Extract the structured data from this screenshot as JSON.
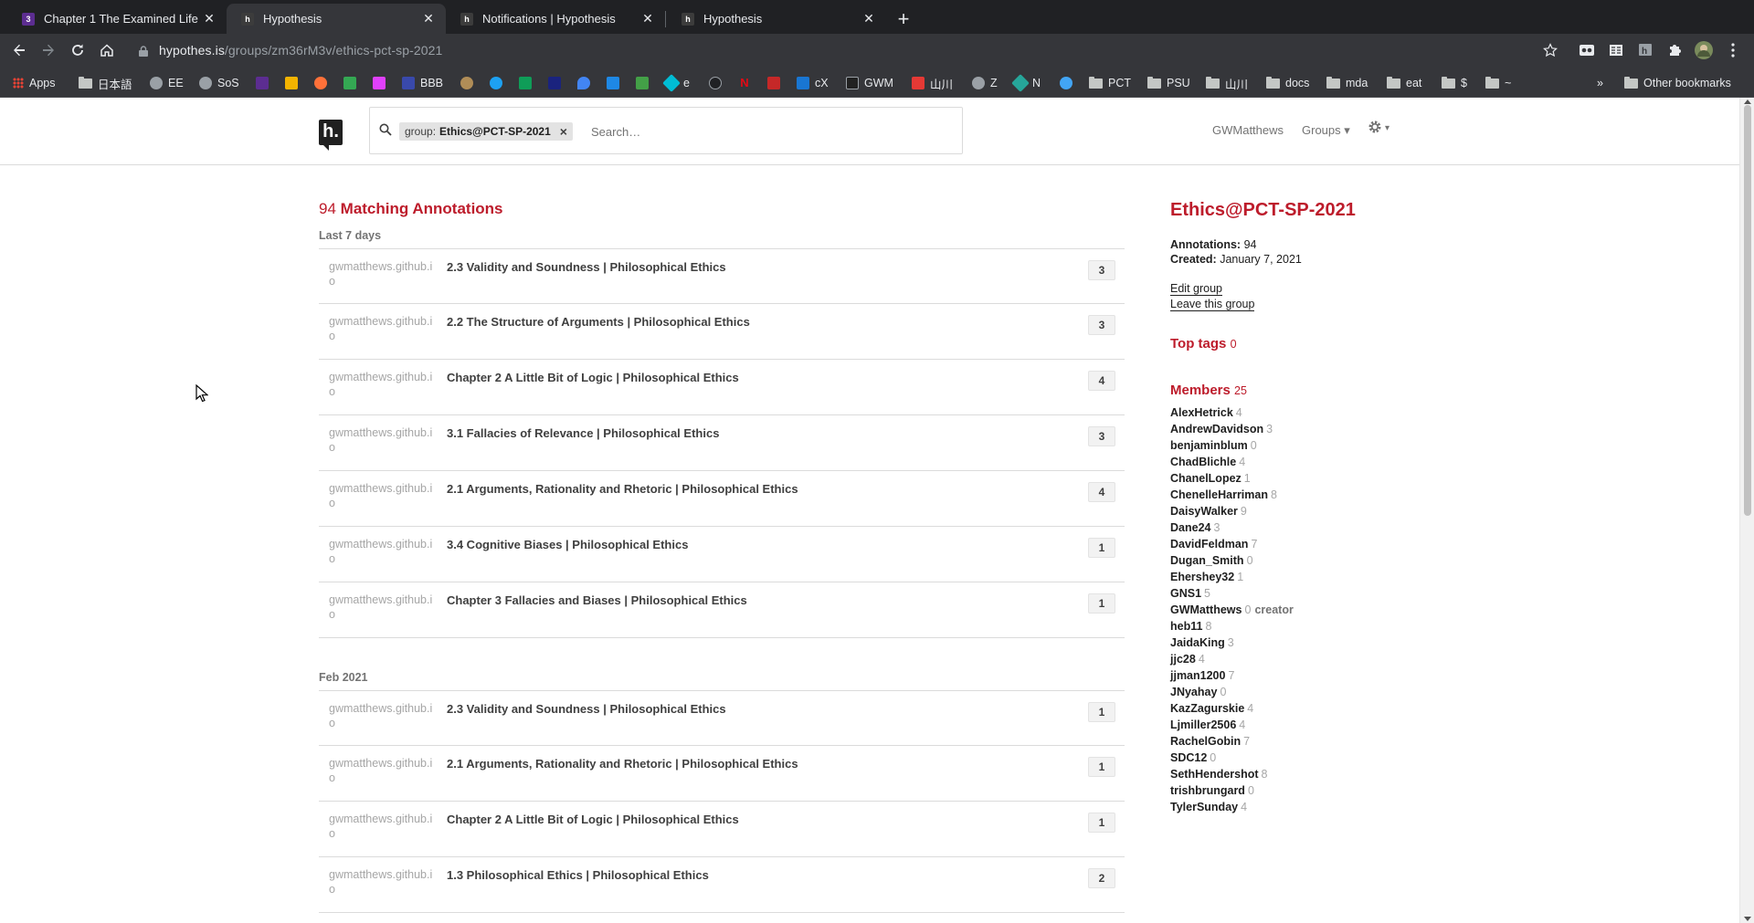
{
  "browser": {
    "tabs": [
      {
        "title": "Chapter 1 The Examined Life |",
        "active": false
      },
      {
        "title": "Hypothesis",
        "active": true
      },
      {
        "title": "Notifications | Hypothesis",
        "active": false
      },
      {
        "title": "Hypothesis",
        "active": false
      }
    ],
    "url_host": "hypothes.is",
    "url_path": "/groups/zm36rM3v/ethics-pct-sp-2021",
    "bookmarks": [
      "Apps",
      "日本語",
      "EE",
      "SoS",
      "BBB",
      "e",
      "cX",
      "GWM",
      "山川",
      "Z",
      "N",
      "PCT",
      "PSU",
      "山川",
      "docs",
      "mda",
      "eat",
      "$",
      "~",
      "»",
      "Other bookmarks"
    ]
  },
  "header": {
    "logo": "h.",
    "search_filter_key": "group:",
    "search_filter_value": "Ethics@PCT-SP-2021",
    "search_placeholder": "Search…",
    "user": "GWMatthews",
    "groups_label": "Groups ▾",
    "settings_caret": "▾"
  },
  "results": {
    "count": "94",
    "label": "Matching Annotations",
    "sections": [
      {
        "label": "Last 7 days",
        "rows": [
          {
            "domain": "gwmatthews.github.io",
            "title": "2.3 Validity and Soundness | Philosophical Ethics",
            "count": "3"
          },
          {
            "domain": "gwmatthews.github.io",
            "title": "2.2 The Structure of Arguments | Philosophical Ethics",
            "count": "3"
          },
          {
            "domain": "gwmatthews.github.io",
            "title": "Chapter 2 A Little Bit of Logic | Philosophical Ethics",
            "count": "4"
          },
          {
            "domain": "gwmatthews.github.io",
            "title": "3.1 Fallacies of Relevance | Philosophical Ethics",
            "count": "3"
          },
          {
            "domain": "gwmatthews.github.io",
            "title": "2.1 Arguments, Rationality and Rhetoric | Philosophical Ethics",
            "count": "4"
          },
          {
            "domain": "gwmatthews.github.io",
            "title": "3.4 Cognitive Biases | Philosophical Ethics",
            "count": "1"
          },
          {
            "domain": "gwmatthews.github.io",
            "title": "Chapter 3 Fallacies and Biases | Philosophical Ethics",
            "count": "1"
          }
        ]
      },
      {
        "label": "Feb 2021",
        "rows": [
          {
            "domain": "gwmatthews.github.io",
            "title": "2.3 Validity and Soundness | Philosophical Ethics",
            "count": "1"
          },
          {
            "domain": "gwmatthews.github.io",
            "title": "2.1 Arguments, Rationality and Rhetoric | Philosophical Ethics",
            "count": "1"
          },
          {
            "domain": "gwmatthews.github.io",
            "title": "Chapter 2 A Little Bit of Logic | Philosophical Ethics",
            "count": "1"
          },
          {
            "domain": "gwmatthews.github.io",
            "title": "1.3 Philosophical Ethics | Philosophical Ethics",
            "count": "2"
          }
        ]
      }
    ]
  },
  "group": {
    "name": "Ethics@PCT-SP-2021",
    "annotations_label": "Annotations:",
    "annotations": "94",
    "created_label": "Created:",
    "created": "January 7, 2021",
    "edit_link": "Edit group",
    "leave_link": "Leave this group",
    "tags_heading": "Top tags",
    "tags_count": "0",
    "members_heading": "Members",
    "members_count": "25",
    "members": [
      {
        "name": "AlexHetrick",
        "count": "4",
        "role": ""
      },
      {
        "name": "AndrewDavidson",
        "count": "3",
        "role": ""
      },
      {
        "name": "benjaminblum",
        "count": "0",
        "role": ""
      },
      {
        "name": "ChadBlichle",
        "count": "4",
        "role": ""
      },
      {
        "name": "ChanelLopez",
        "count": "1",
        "role": ""
      },
      {
        "name": "ChenelleHarriman",
        "count": "8",
        "role": ""
      },
      {
        "name": "DaisyWalker",
        "count": "9",
        "role": ""
      },
      {
        "name": "Dane24",
        "count": "3",
        "role": ""
      },
      {
        "name": "DavidFeldman",
        "count": "7",
        "role": ""
      },
      {
        "name": "Dugan_Smith",
        "count": "0",
        "role": ""
      },
      {
        "name": "Ehershey32",
        "count": "1",
        "role": ""
      },
      {
        "name": "GNS1",
        "count": "5",
        "role": ""
      },
      {
        "name": "GWMatthews",
        "count": "0",
        "role": "creator"
      },
      {
        "name": "heb11",
        "count": "8",
        "role": ""
      },
      {
        "name": "JaidaKing",
        "count": "3",
        "role": ""
      },
      {
        "name": "jjc28",
        "count": "4",
        "role": ""
      },
      {
        "name": "jjman1200",
        "count": "7",
        "role": ""
      },
      {
        "name": "JNyahay",
        "count": "0",
        "role": ""
      },
      {
        "name": "KazZagurskie",
        "count": "4",
        "role": ""
      },
      {
        "name": "Ljmiller2506",
        "count": "4",
        "role": ""
      },
      {
        "name": "RachelGobin",
        "count": "7",
        "role": ""
      },
      {
        "name": "SDC12",
        "count": "0",
        "role": ""
      },
      {
        "name": "SethHendershot",
        "count": "8",
        "role": ""
      },
      {
        "name": "trishbrungard",
        "count": "0",
        "role": ""
      },
      {
        "name": "TylerSunday",
        "count": "4",
        "role": ""
      }
    ]
  },
  "colors": {
    "brand": "#bd1c2b",
    "chrome_dark": "#202124",
    "chrome_toolbar": "#35363a"
  }
}
